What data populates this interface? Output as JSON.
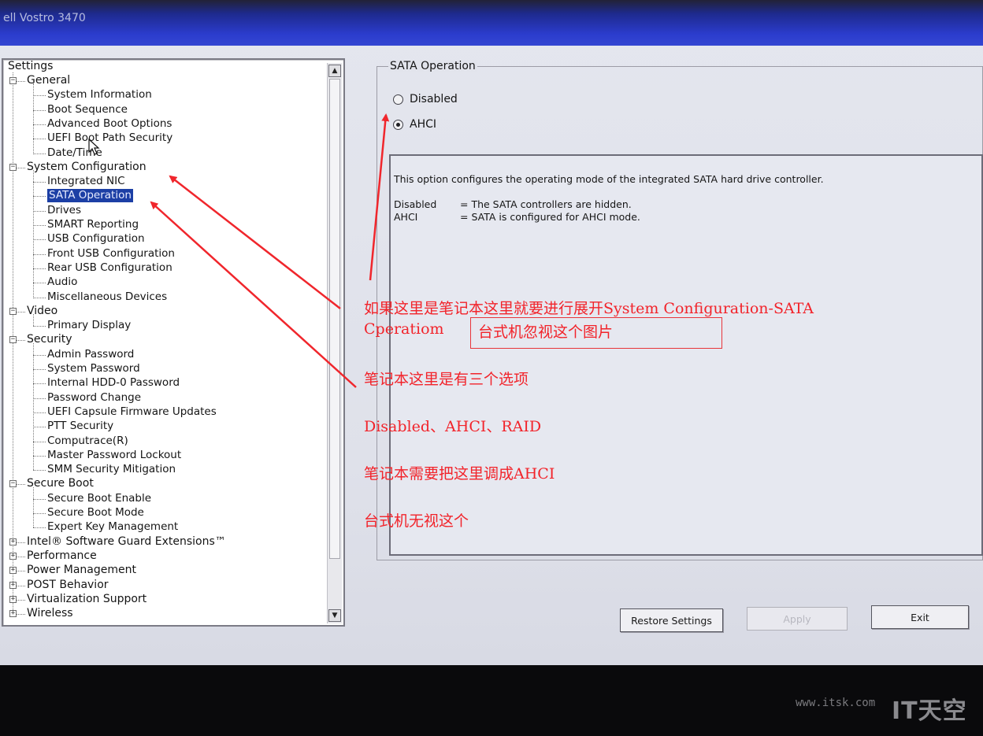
{
  "window": {
    "title": "ell Vostro 3470"
  },
  "tree": {
    "heading": "Settings",
    "groups": [
      {
        "label": "General",
        "expanded": true,
        "items": [
          "System Information",
          "Boot Sequence",
          "Advanced Boot Options",
          "UEFI Boot Path Security",
          "Date/Time"
        ]
      },
      {
        "label": "System Configuration",
        "expanded": true,
        "items": [
          "Integrated NIC",
          "SATA Operation",
          "Drives",
          "SMART Reporting",
          "USB Configuration",
          "Front USB Configuration",
          "Rear USB Configuration",
          "Audio",
          "Miscellaneous Devices"
        ]
      },
      {
        "label": "Video",
        "expanded": true,
        "items": [
          "Primary Display"
        ]
      },
      {
        "label": "Security",
        "expanded": true,
        "items": [
          "Admin Password",
          "System Password",
          "Internal HDD-0 Password",
          "Password Change",
          "UEFI Capsule Firmware Updates",
          "PTT Security",
          "Computrace(R)",
          "Master Password Lockout",
          "SMM Security Mitigation"
        ]
      },
      {
        "label": "Secure Boot",
        "expanded": true,
        "items": [
          "Secure Boot Enable",
          "Secure Boot Mode",
          "Expert Key Management"
        ]
      },
      {
        "label": "Intel® Software Guard Extensions™",
        "expanded": false,
        "items": []
      },
      {
        "label": "Performance",
        "expanded": false,
        "items": []
      },
      {
        "label": "Power Management",
        "expanded": false,
        "items": []
      },
      {
        "label": "POST Behavior",
        "expanded": false,
        "items": []
      },
      {
        "label": "Virtualization Support",
        "expanded": false,
        "items": []
      },
      {
        "label": "Wireless",
        "expanded": false,
        "items": []
      }
    ],
    "selected": "SATA Operation"
  },
  "panel": {
    "title": "SATA Operation",
    "options": [
      {
        "label": "Disabled",
        "checked": false
      },
      {
        "label": "AHCI",
        "checked": true
      }
    ],
    "description": "This option configures the operating mode of the integrated SATA hard drive controller.",
    "definitions": [
      {
        "key": "Disabled",
        "value": "= The SATA controllers are hidden."
      },
      {
        "key": "AHCI",
        "value": "= SATA is configured for AHCI mode."
      }
    ]
  },
  "buttons": {
    "restore": "Restore Settings",
    "apply": "Apply",
    "exit": "Exit"
  },
  "annotations": {
    "line1": "如果这里是笔记本这里就要进行展开System Configuration-SATA",
    "line2": "Cperatiom",
    "boxed": "台式机忽视这个图片",
    "line3": "笔记本这里是有三个选项",
    "line4": "Disabled、AHCI、RAID",
    "line5": "笔记本需要把这里调成AHCI",
    "line6": "台式机无视这个",
    "color": "#f2232a"
  },
  "watermark": {
    "url": "www.itsk.com",
    "logo": "IT天空"
  },
  "colors": {
    "titlebar": "#2b3ccd",
    "selection": "#1c3fa5",
    "annotation": "#f2232a"
  }
}
